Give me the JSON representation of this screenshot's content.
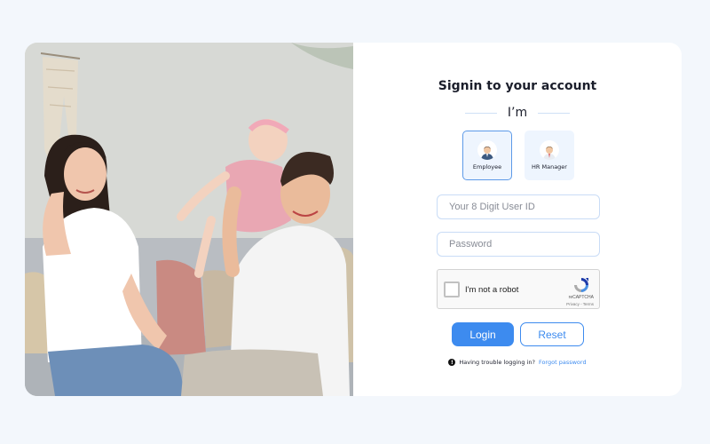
{
  "signin": {
    "title": "Signin to your account",
    "im_label": "I’m"
  },
  "roles": [
    {
      "label": "Employee",
      "icon": "employee-avatar-icon",
      "selected": true
    },
    {
      "label": "HR Manager",
      "icon": "hr-manager-avatar-icon",
      "selected": false
    }
  ],
  "fields": {
    "user_id_placeholder": "Your 8 Digit User ID",
    "password_placeholder": "Password"
  },
  "captcha": {
    "label": "I'm not a robot",
    "brand": "reCAPTCHA",
    "terms": "Privacy - Terms"
  },
  "buttons": {
    "login": "Login",
    "reset": "Reset"
  },
  "help": {
    "trouble_text": "Having trouble logging in?",
    "forgot_link": "Forgot password"
  },
  "colors": {
    "accent": "#3d8bef",
    "page_background": "#f3f7fc",
    "role_tile_background": "#eef5fe"
  }
}
